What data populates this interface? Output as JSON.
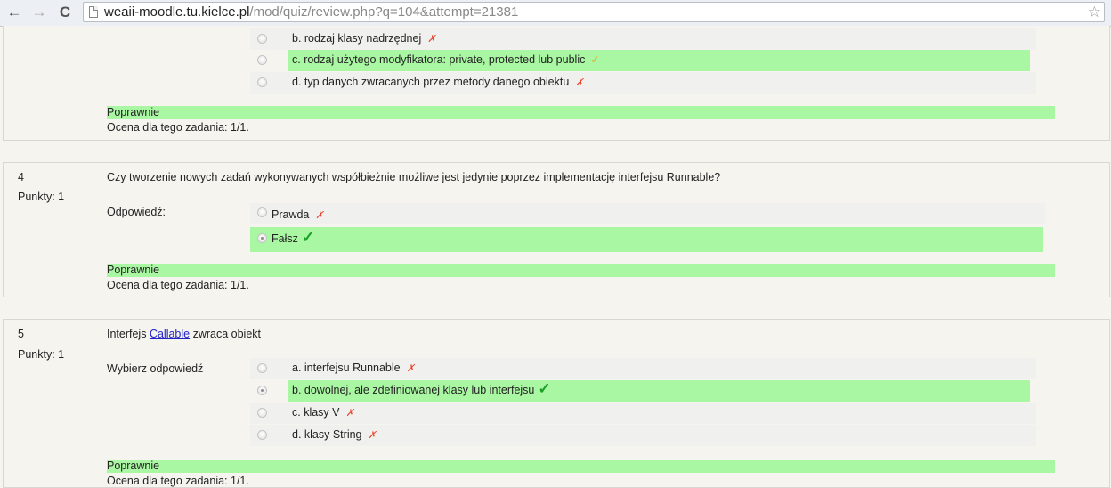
{
  "browser": {
    "back": "←",
    "forward": "→",
    "reload": "C",
    "url_host": "weaii-moodle.tu.kielce.pl",
    "url_path": "/mod/quiz/review.php?q=104&attempt=21381",
    "star": "☆"
  },
  "q3": {
    "options": [
      {
        "label": "b. rodzaj klasy nadrzędnej",
        "mark": "✗"
      },
      {
        "label": "c. rodzaj użytego modyfikatora: private, protected lub public",
        "mark": "✓"
      },
      {
        "label": "d. typ danych zwracanych przez metody danego obiektu",
        "mark": "✗"
      }
    ],
    "feedback": "Poprawnie",
    "grade": "Ocena dla tego zadania: 1/1."
  },
  "q4": {
    "number": "4",
    "points": "Punkty: 1",
    "text": "Czy tworzenie nowych zadań wykonywanych współbieżnie możliwe jest jedynie poprzez implementację interfejsu Runnable?",
    "prompt": "Odpowiedź:",
    "options": [
      {
        "label": "Prawda",
        "mark": "✗"
      },
      {
        "label": "Fałsz",
        "mark": "✓"
      }
    ],
    "feedback": "Poprawnie",
    "grade": "Ocena dla tego zadania: 1/1."
  },
  "q5": {
    "number": "5",
    "points": "Punkty: 1",
    "text_before": "Interfejs ",
    "text_link": "Callable",
    "text_after": " zwraca obiekt",
    "prompt": "Wybierz odpowiedź",
    "options": [
      {
        "label": "a. interfejsu Runnable",
        "mark": "✗"
      },
      {
        "label": "b. dowolnej, ale zdefiniowanej klasy lub interfejsu",
        "mark": "✓"
      },
      {
        "label": "c. klasy V",
        "mark": "✗"
      },
      {
        "label": "d. klasy String",
        "mark": "✗"
      }
    ],
    "feedback": "Poprawnie",
    "grade": "Ocena dla tego zadania: 1/1."
  },
  "colors": {
    "correct_bg": "#aaf7a3",
    "option_bg": "#f0f0ee",
    "incorrect_mark": "#e8452d",
    "correct_mark": "#1aa127",
    "link": "#2323c8"
  }
}
